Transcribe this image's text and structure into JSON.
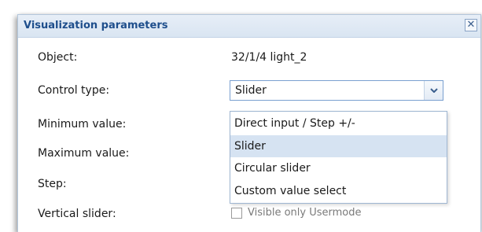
{
  "dialog": {
    "title": "Visualization parameters",
    "close_glyph": "✕"
  },
  "fields": {
    "object_label": "Object:",
    "object_value": "32/1/4 light_2",
    "control_type_label": "Control type:",
    "control_type_value": "Slider",
    "minimum_label": "Minimum value:",
    "maximum_label": "Maximum value:",
    "step_label": "Step:",
    "vertical_slider_label": "Vertical slider:",
    "visible_only_usermode_label": "Visible only Usermode"
  },
  "dropdown": {
    "options": [
      "Direct input / Step +/-",
      "Slider",
      "Circular slider",
      "Custom value select"
    ],
    "selected": "Slider"
  },
  "checkbox": {
    "visible_only_usermode_checked": false
  },
  "colors": {
    "title_text": "#1e4e8c",
    "titlebar_bg": "#dfe8f4",
    "selected_option_bg": "#d6e3f2",
    "select_border": "#7aa0d0"
  },
  "icons": {
    "close": "close-icon",
    "dropdown_arrow": "chevron-down-icon"
  }
}
